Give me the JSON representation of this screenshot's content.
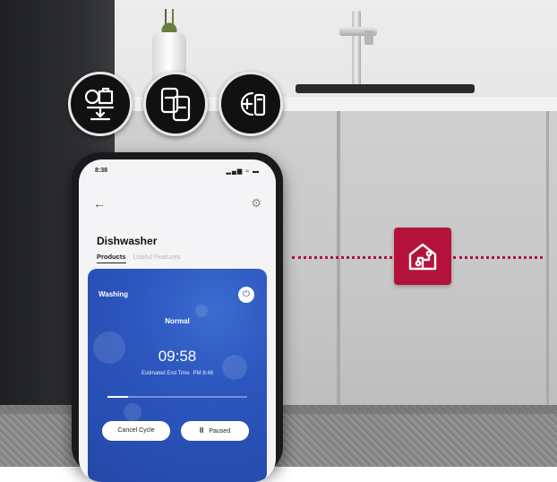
{
  "phone": {
    "status_time": "8:38",
    "status_icons": "▂▄▆ ≈ ▬",
    "back_glyph": "←",
    "settings_glyph": "⚙",
    "title": "Dishwasher",
    "tabs": [
      {
        "label": "Products",
        "active": true
      },
      {
        "label": "Useful Features",
        "active": false
      }
    ],
    "card": {
      "status": "Washing",
      "power_glyph": "⏻",
      "course": "Normal",
      "time_left": "09:58",
      "end_label": "Estimated End Time",
      "end_time": "PM 8:48",
      "progress": 0.15,
      "cancel_label": "Cancel Cycle",
      "pause_glyph": "II",
      "pause_label": "Paused"
    }
  },
  "feature_icons": [
    "dishwasher-download-icon",
    "smartphone-sync-icon",
    "add-device-icon"
  ],
  "hub_icon": "smart-home-icon",
  "colors": {
    "brand_red": "#b5123b",
    "card_blue": "#2c57bf"
  }
}
